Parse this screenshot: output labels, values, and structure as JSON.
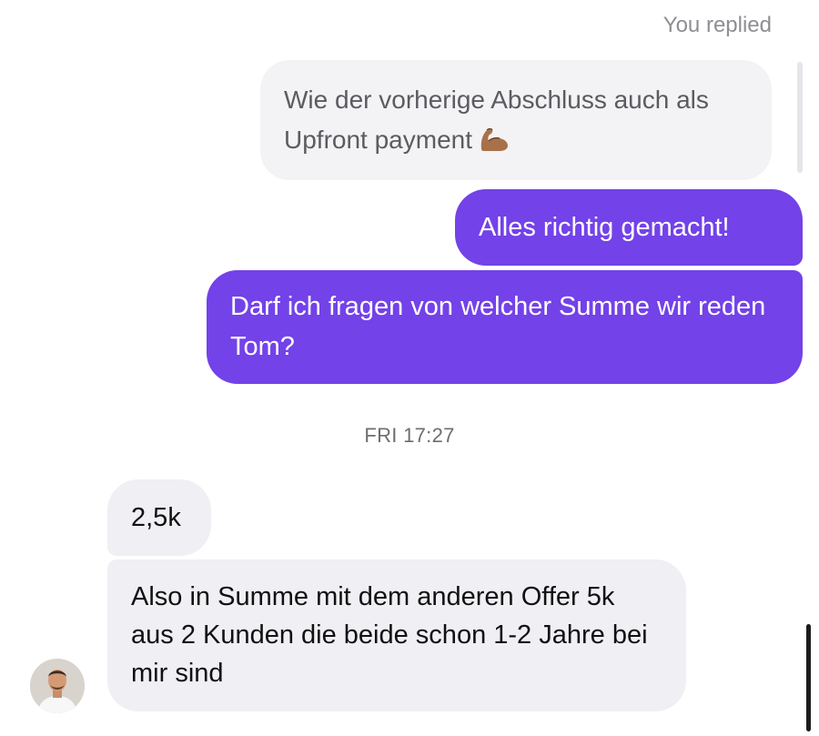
{
  "reply": {
    "label": "You replied",
    "quoted_text": "Wie der vorherige Abschluss auch als Upfront payment",
    "quoted_emoji": "flexed-biceps-emoji"
  },
  "outgoing": [
    {
      "text": "Alles richtig gemacht!"
    },
    {
      "text": "Darf ich fragen von welcher Summe wir reden Tom?"
    }
  ],
  "timestamp": "FRI 17:27",
  "incoming": [
    {
      "text": "2,5k"
    },
    {
      "text": "Also in Summe mit dem anderen Offer 5k aus 2 Kunden die beide schon 1-2 Jahre bei mir sind"
    }
  ],
  "colors": {
    "outgoing_bubble": "#7342e8",
    "incoming_bubble": "#efeff4",
    "quoted_bubble": "#f3f3f5"
  }
}
